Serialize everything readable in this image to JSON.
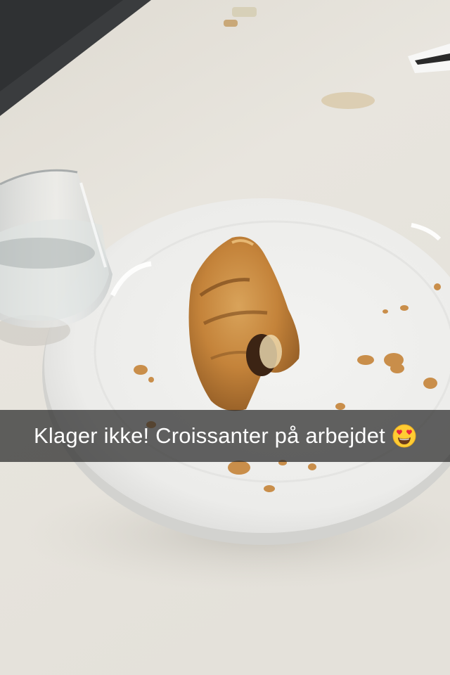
{
  "caption": {
    "text": "Klager ikke! Croissanter på arbejdet",
    "emoji": "heart-eyes-emoji"
  },
  "colors": {
    "table": "#e9e6df",
    "plate": "#f1f1ef",
    "caption_bar": "#282828",
    "caption_text": "#ffffff"
  }
}
